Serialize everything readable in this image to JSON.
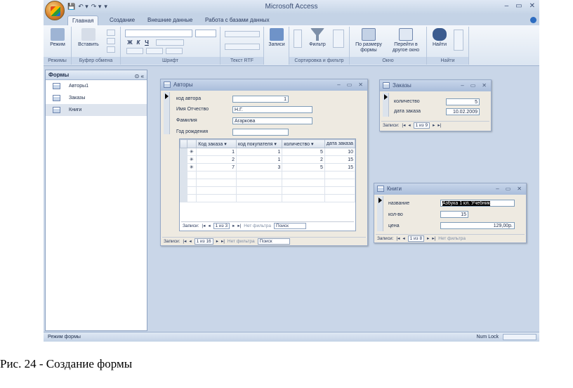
{
  "app": {
    "title": "Microsoft Access",
    "quick_access": [
      "💾",
      "↶ ▾",
      "↷ ▾",
      "▾"
    ],
    "window_controls": [
      "–",
      "▭",
      "✕"
    ]
  },
  "tabs": [
    "Главная",
    "Создание",
    "Внешние данные",
    "Работа с базами данных"
  ],
  "ribbon": {
    "view": "Режим",
    "paste": "Вставить",
    "search": "Найти",
    "filter": "Фильтр",
    "records": "Записи",
    "fit": "По размеру формы",
    "goto": "Перейти в другое окно",
    "groups": [
      "Режимы",
      "Буфер обмена",
      "Шрифт",
      "Текст RTF",
      "Сортировка и фильтр",
      "Окно",
      "Найти"
    ],
    "font_letters": [
      "Ж",
      "К",
      "Ч"
    ]
  },
  "nav": {
    "header": "Формы",
    "header_controls": [
      "⊙",
      "«"
    ],
    "items": [
      "Авторы1",
      "Заказы",
      "Книги"
    ]
  },
  "status": {
    "left": "Режим формы",
    "right": "Num Lock"
  },
  "authors_form": {
    "title": "Авторы",
    "fields": [
      {
        "label": "код автора",
        "value": "1"
      },
      {
        "label": "Имя Отчество",
        "value": "Н.Г."
      },
      {
        "label": "Фамилия",
        "value": "Агаркова"
      },
      {
        "label": "Год рождения",
        "value": ""
      }
    ],
    "subform": {
      "columns": [
        "Код заказа",
        "код покупателя",
        "количество",
        "дата заказа"
      ],
      "rows": [
        {
          "mark": "✳",
          "cells": [
            "1",
            "1",
            "5",
            "10"
          ]
        },
        {
          "mark": "✳",
          "cells": [
            "2",
            "1",
            "2",
            "15"
          ]
        },
        {
          "mark": "✳",
          "cells": [
            "7",
            "3",
            "5",
            "15"
          ]
        }
      ],
      "nav": {
        "label": "Записи:",
        "current": "1 из 3",
        "filter": "Нет фильтра",
        "search": "Поиск"
      }
    },
    "nav": {
      "label": "Записи:",
      "current": "1 из 16",
      "filter": "Нет фильтра",
      "search": "Поиск"
    }
  },
  "orders_form": {
    "title": "Заказы",
    "fields": [
      {
        "label": "количество",
        "value": "5"
      },
      {
        "label": "дата заказа",
        "value": "10.02.2009"
      }
    ],
    "nav": {
      "label": "Записи:",
      "current": "1 из 9"
    }
  },
  "books_form": {
    "title": "Книги",
    "fields": [
      {
        "label": "название",
        "value": "Азбука 1 кл. Учебник"
      },
      {
        "label": "кол-во",
        "value": "15"
      },
      {
        "label": "цена",
        "value": "129,00р."
      }
    ],
    "nav": {
      "label": "Записи:",
      "current": "1 из 8",
      "filter": "Нет фильтра"
    }
  },
  "caption": "Рис. 24 - Создание формы"
}
